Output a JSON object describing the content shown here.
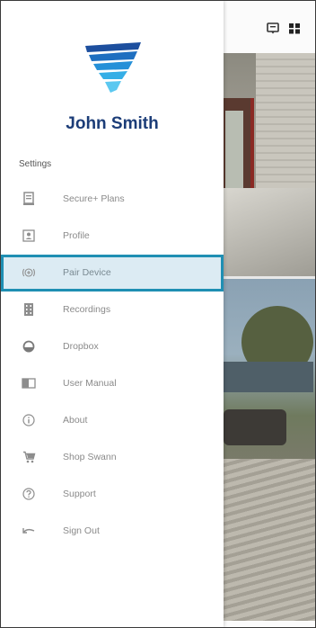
{
  "user": {
    "name": "John Smith"
  },
  "drawer": {
    "section_label": "Settings",
    "items": [
      {
        "label": "Secure+ Plans",
        "icon": "document-icon"
      },
      {
        "label": "Profile",
        "icon": "profile-icon"
      },
      {
        "label": "Pair Device",
        "icon": "pair-device-icon",
        "active": true
      },
      {
        "label": "Recordings",
        "icon": "recordings-icon"
      },
      {
        "label": "Dropbox",
        "icon": "dropbox-icon"
      },
      {
        "label": "User Manual",
        "icon": "book-icon"
      },
      {
        "label": "About",
        "icon": "info-icon"
      },
      {
        "label": "Shop Swann",
        "icon": "cart-icon"
      },
      {
        "label": "Support",
        "icon": "help-icon"
      },
      {
        "label": "Sign Out",
        "icon": "sign-out-icon"
      }
    ]
  },
  "header_icons": [
    "chat-icon",
    "grid-icon"
  ],
  "colors": {
    "accent": "#1f8fb3",
    "active_bg": "#dcebf3",
    "name": "#1c3d78"
  }
}
